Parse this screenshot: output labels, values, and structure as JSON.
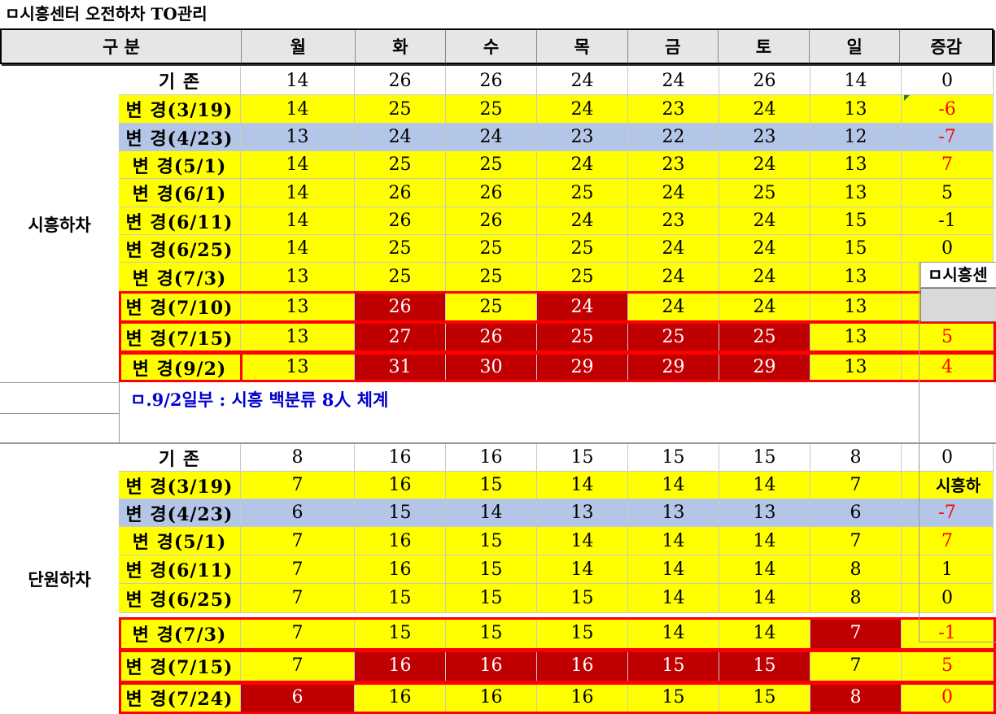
{
  "title": "ㅁ시흥센터 오전하차 TO관리",
  "header": {
    "columns": [
      "구 분",
      "월",
      "화",
      "수",
      "목",
      "금",
      "토",
      "일",
      "증감"
    ]
  },
  "groups": [
    {
      "name": "시흥하차",
      "rows": [
        {
          "label": "기 존",
          "values": [
            "14",
            "26",
            "26",
            "24",
            "24",
            "26",
            "14"
          ],
          "diff": "0"
        },
        {
          "label": "변 경(3/19)",
          "values": [
            "14",
            "25",
            "25",
            "24",
            "23",
            "24",
            "13"
          ],
          "diff": "-6"
        },
        {
          "label": "변 경(4/23)",
          "values": [
            "13",
            "24",
            "24",
            "23",
            "22",
            "23",
            "12"
          ],
          "diff": "-7"
        },
        {
          "label": "변 경(5/1)",
          "values": [
            "14",
            "25",
            "25",
            "24",
            "23",
            "24",
            "13"
          ],
          "diff": "7"
        },
        {
          "label": "변 경(6/1)",
          "values": [
            "14",
            "26",
            "26",
            "25",
            "24",
            "25",
            "13"
          ],
          "diff": "5"
        },
        {
          "label": "변 경(6/11)",
          "values": [
            "14",
            "26",
            "26",
            "24",
            "23",
            "24",
            "15"
          ],
          "diff": "-1"
        },
        {
          "label": "변 경(6/25)",
          "values": [
            "14",
            "25",
            "25",
            "25",
            "24",
            "24",
            "15"
          ],
          "diff": "0"
        },
        {
          "label": "변 경(7/3)",
          "values": [
            "13",
            "25",
            "25",
            "25",
            "24",
            "24",
            "13"
          ],
          "diff": ""
        },
        {
          "label": "변 경(7/10)",
          "values": [
            "13",
            "26",
            "25",
            "24",
            "24",
            "24",
            "13"
          ],
          "diff": ""
        },
        {
          "label": "변 경(7/15)",
          "values": [
            "13",
            "27",
            "26",
            "25",
            "25",
            "25",
            "13"
          ],
          "diff": "5"
        },
        {
          "label": "변 경(9/2)",
          "values": [
            "13",
            "31",
            "30",
            "29",
            "29",
            "29",
            "13"
          ],
          "diff": "4"
        }
      ]
    },
    {
      "name": "단원하차",
      "rows": [
        {
          "label": "기 존",
          "values": [
            "8",
            "16",
            "16",
            "15",
            "15",
            "15",
            "8"
          ],
          "diff": "0"
        },
        {
          "label": "변 경(3/19)",
          "values": [
            "7",
            "16",
            "15",
            "14",
            "14",
            "14",
            "7"
          ],
          "diff": ""
        },
        {
          "label": "변 경(4/23)",
          "values": [
            "6",
            "15",
            "14",
            "13",
            "13",
            "13",
            "6"
          ],
          "diff": "-7"
        },
        {
          "label": "변 경(5/1)",
          "values": [
            "7",
            "16",
            "15",
            "14",
            "14",
            "14",
            "7"
          ],
          "diff": "7"
        },
        {
          "label": "변 경(6/11)",
          "values": [
            "7",
            "16",
            "15",
            "14",
            "14",
            "14",
            "8"
          ],
          "diff": "1"
        },
        {
          "label": "변 경(6/25)",
          "values": [
            "7",
            "15",
            "15",
            "15",
            "14",
            "14",
            "8"
          ],
          "diff": "0"
        },
        {
          "label": "변 경(7/3)",
          "values": [
            "7",
            "15",
            "15",
            "15",
            "14",
            "14",
            "7"
          ],
          "diff": "-1"
        },
        {
          "label": "변 경(7/15)",
          "values": [
            "7",
            "16",
            "16",
            "16",
            "15",
            "15",
            "7"
          ],
          "diff": "5"
        },
        {
          "label": "변 경(7/24)",
          "values": [
            "6",
            "16",
            "16",
            "16",
            "15",
            "15",
            "8"
          ],
          "diff": "0"
        }
      ]
    }
  ],
  "note": "ㅁ.9/2일부 : 시흥 백분류 8人 체계",
  "overlay": {
    "box1_text": "ㅁ시흥센",
    "box2_text": "시흥하"
  },
  "colors": {
    "yellow": "#ffff00",
    "blue": "#b4c6e7",
    "dark_red": "#c00000",
    "outline_red": "#ff0000",
    "note_blue": "#0000cc"
  }
}
